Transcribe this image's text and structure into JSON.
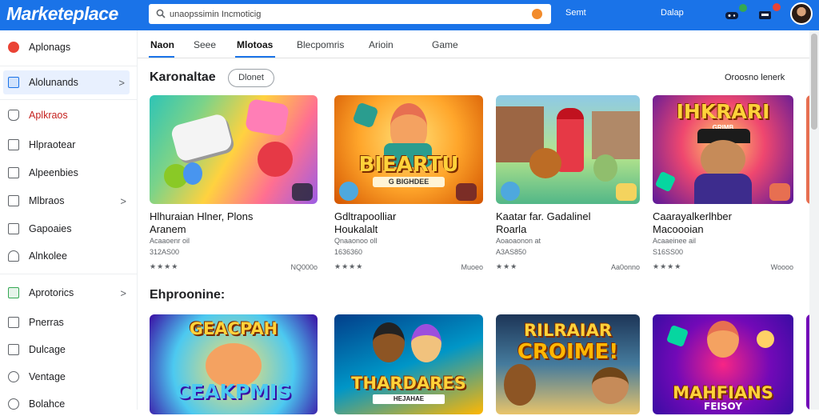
{
  "header": {
    "logo": "Marketeplace",
    "search": {
      "value": "unaopssimin Incmoticig",
      "placeholder": ""
    },
    "button1": "Semt",
    "button2": "Dalap"
  },
  "sidebar": {
    "items": [
      {
        "label": "Aplonags",
        "icon": "app-icon"
      },
      {
        "label": "Alolunands",
        "icon": "grid-icon",
        "active": true,
        "chevron": ">"
      },
      {
        "label": "Aplkraos",
        "icon": "bag-icon",
        "red": true
      },
      {
        "label": "Hlpraotear",
        "icon": "card-icon"
      },
      {
        "label": "Alpeenbies",
        "icon": "doc-icon"
      },
      {
        "label": "Mlbraos",
        "icon": "mail-icon",
        "chevron": ">"
      },
      {
        "label": "Gapoaies",
        "icon": "list-icon"
      },
      {
        "label": "Alnkolee",
        "icon": "home-icon"
      },
      {
        "label": "Aprotorics",
        "icon": "chart-icon",
        "chevron": ">"
      },
      {
        "label": "Pnerras",
        "icon": "box-icon"
      },
      {
        "label": "Dulcage",
        "icon": "edit-icon"
      },
      {
        "label": "Ventage",
        "icon": "eye-icon"
      },
      {
        "label": "Bolahce",
        "icon": "gear-icon"
      }
    ]
  },
  "tabs": [
    {
      "label": "Naon",
      "active": true
    },
    {
      "label": "Seee"
    },
    {
      "label": "Mlotoas",
      "bold": true
    },
    {
      "label": "Blecpomris"
    },
    {
      "label": "Arioin"
    },
    {
      "label": "Game"
    }
  ],
  "section1": {
    "title": "Karonaltae",
    "pill": "Dlonet",
    "see_all": "Oroosno lenerk",
    "cards": [
      {
        "title1": "Hlhuraian Hlner, Plons",
        "title2": "Aranem",
        "meta1": "Acaaoenr oil",
        "meta2": "312AS00",
        "stars": "★★★★",
        "price": "NQ000o",
        "badge": "oo"
      },
      {
        "title1": "Gdltrapoolliar",
        "title2": "Houkalalt",
        "meta1": "Qnaaonoo oll",
        "meta2": "1636360",
        "stars": "★★★★",
        "price": "Muoeo",
        "art_text": "BIEARTU",
        "art_sub": "G BIGHDEE"
      },
      {
        "title1": "Kaatar far. Gadalinel",
        "title2": "Roarla",
        "meta1": "Aoaoaonon at",
        "meta2": "A3AS850",
        "stars": "★★★",
        "price": "Aa0onno"
      },
      {
        "title1": "Caarayalkerlhber",
        "title2": "Macoooian",
        "meta1": "Acaaeinee ail",
        "meta2": "S16SS00",
        "stars": "★★★★",
        "price": "Woooo",
        "art_text": "IHKRARI",
        "art_sub": "GRIMB"
      }
    ]
  },
  "section2": {
    "title": "Ehproonine:",
    "cards": [
      {
        "art_text": "GEACPAH",
        "art_sub": "CEAKPMIS"
      },
      {
        "art_text": "THARDARES",
        "art_sub": "HEJAHAE"
      },
      {
        "art_text": "RILRAIAR",
        "art_sub": "CROIME!"
      },
      {
        "art_text": "MAHFIANS",
        "art_sub": "FEISOY"
      }
    ]
  },
  "colors": {
    "header_bg": "#1a73e8",
    "active_bg": "#e8f0fe",
    "accent": "#1a73e8",
    "red_text": "#c5221f"
  }
}
